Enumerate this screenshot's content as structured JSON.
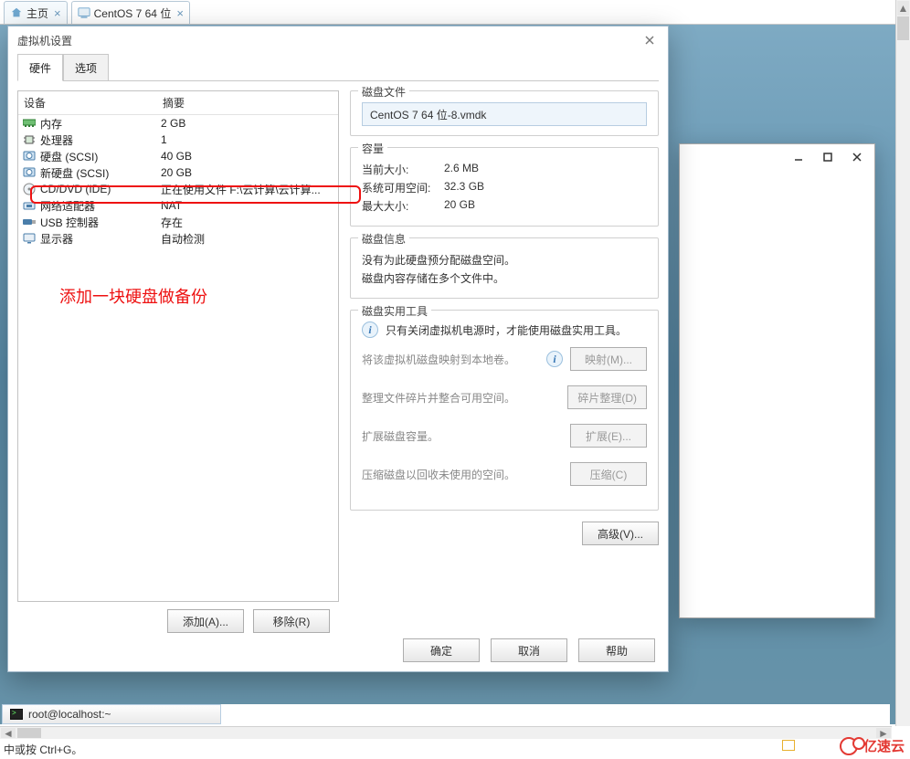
{
  "tabs": {
    "home": "主页",
    "vm": "CentOS 7 64 位"
  },
  "dialog": {
    "title": "虚拟机设置",
    "tab_hardware": "硬件",
    "tab_options": "选项",
    "col_device": "设备",
    "col_summary": "摘要",
    "rows": [
      {
        "name": "内存",
        "summary": "2 GB",
        "icon": "ram"
      },
      {
        "name": "处理器",
        "summary": "1",
        "icon": "cpu"
      },
      {
        "name": "硬盘 (SCSI)",
        "summary": "40 GB",
        "icon": "hdd"
      },
      {
        "name": "新硬盘 (SCSI)",
        "summary": "20 GB",
        "icon": "hdd"
      },
      {
        "name": "CD/DVD (IDE)",
        "summary": "正在使用文件 F:\\云计算\\云计算...",
        "icon": "cd"
      },
      {
        "name": "网络适配器",
        "summary": "NAT",
        "icon": "net"
      },
      {
        "name": "USB 控制器",
        "summary": "存在",
        "icon": "usb"
      },
      {
        "name": "显示器",
        "summary": "自动检测",
        "icon": "display"
      }
    ],
    "annotation": "添加一块硬盘做备份",
    "add_btn": "添加(A)...",
    "remove_btn": "移除(R)"
  },
  "disk": {
    "grp_file": "磁盘文件",
    "file_value": "CentOS 7 64 位-8.vmdk",
    "grp_capacity": "容量",
    "cur_size_k": "当前大小:",
    "cur_size_v": "2.6 MB",
    "free_k": "系统可用空间:",
    "free_v": "32.3 GB",
    "max_k": "最大大小:",
    "max_v": "20 GB",
    "grp_info": "磁盘信息",
    "info1": "没有为此硬盘预分配磁盘空间。",
    "info2": "磁盘内容存储在多个文件中。",
    "grp_util": "磁盘实用工具",
    "util_note": "只有关闭虚拟机电源时，才能使用磁盘实用工具。",
    "map_txt": "将该虚拟机磁盘映射到本地卷。",
    "map_btn": "映射(M)...",
    "defrag_txt": "整理文件碎片并整合可用空间。",
    "defrag_btn": "碎片整理(D)",
    "expand_txt": "扩展磁盘容量。",
    "expand_btn": "扩展(E)...",
    "compact_txt": "压缩磁盘以回收未使用的空间。",
    "compact_btn": "压缩(C)",
    "advanced_btn": "高级(V)..."
  },
  "footer": {
    "ok": "确定",
    "cancel": "取消",
    "help": "帮助"
  },
  "taskbar": {
    "item": "root@localhost:~"
  },
  "statusbar": "中或按 Ctrl+G。",
  "brand": "亿速云"
}
